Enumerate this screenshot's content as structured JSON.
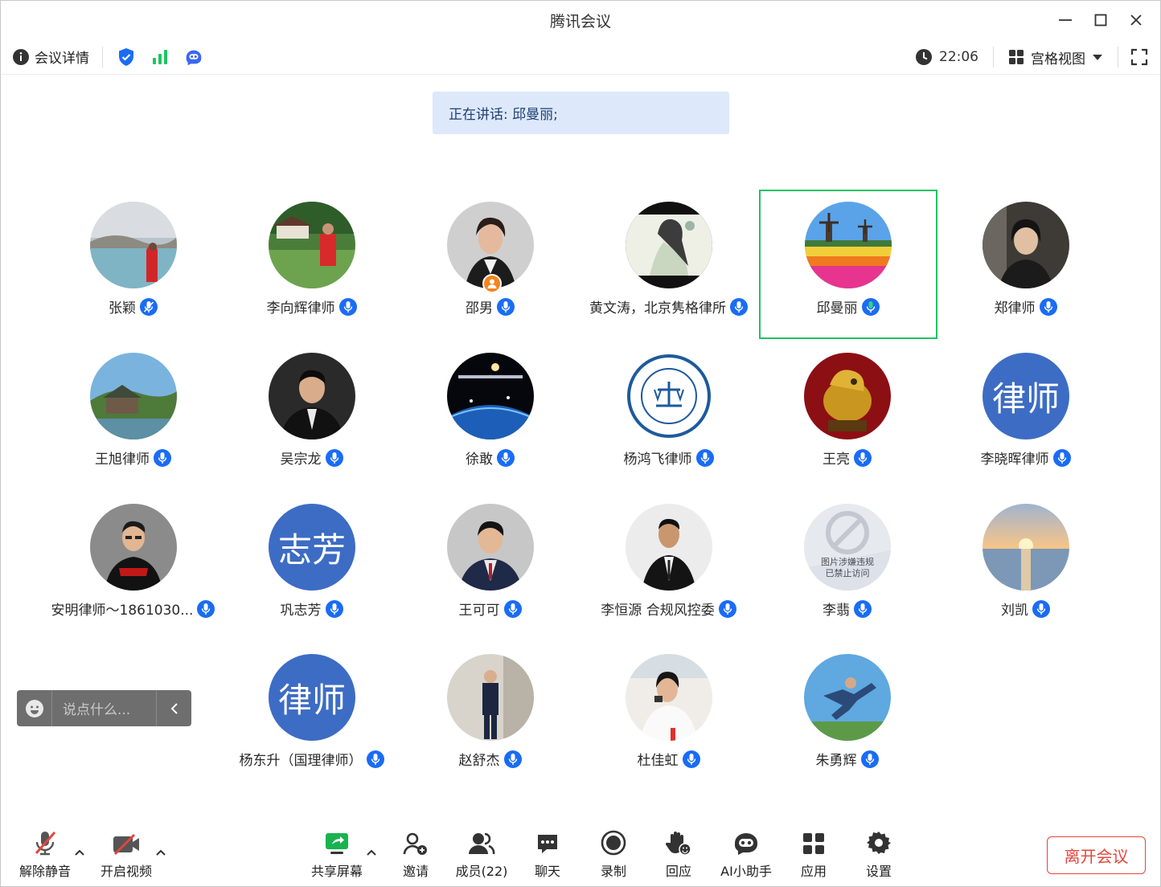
{
  "window": {
    "title": "腾讯会议"
  },
  "toolbar": {
    "meeting_info_label": "会议详情",
    "time": "22:06",
    "view_label": "宫格视图"
  },
  "speaking": {
    "text": "正在讲话: 邱曼丽;"
  },
  "participants": [
    {
      "name": "张颖"
    },
    {
      "name": "李向辉律师"
    },
    {
      "name": "邵男"
    },
    {
      "name": "黄文涛，北京隽格律所"
    },
    {
      "name": "邱曼丽"
    },
    {
      "name": "郑律师"
    },
    {
      "name": "王旭律师"
    },
    {
      "name": "吴宗龙"
    },
    {
      "name": "徐敢"
    },
    {
      "name": "杨鸿飞律师"
    },
    {
      "name": "王亮"
    },
    {
      "name": "李晓晖律师",
      "avatar_text": "律师"
    },
    {
      "name": "安明律师～1861030..."
    },
    {
      "name": "巩志芳",
      "avatar_text": "志芳"
    },
    {
      "name": "王可可"
    },
    {
      "name": "李恒源 合规风控委"
    },
    {
      "name": "李翡",
      "blocked_line1": "图片涉嫌违规",
      "blocked_line2": "已禁止访问"
    },
    {
      "name": "刘凯"
    },
    {
      "name": "杨东升（国理律师）",
      "avatar_text": "律师"
    },
    {
      "name": "赵舒杰"
    },
    {
      "name": "杜佳虹"
    },
    {
      "name": "朱勇辉"
    }
  ],
  "chat": {
    "placeholder": "说点什么..."
  },
  "bottom": {
    "unmute": "解除静音",
    "video": "开启视频",
    "share": "共享屏幕",
    "invite": "邀请",
    "members": "成员(22)",
    "chat": "聊天",
    "record": "录制",
    "react": "回应",
    "ai": "AI小助手",
    "apps": "应用",
    "settings": "设置",
    "leave": "离开会议"
  },
  "colors": {
    "accent": "#1a6cf5",
    "active_border": "#1ec462",
    "leave": "#e2463d",
    "text_avatar": "#3d6cc4"
  }
}
